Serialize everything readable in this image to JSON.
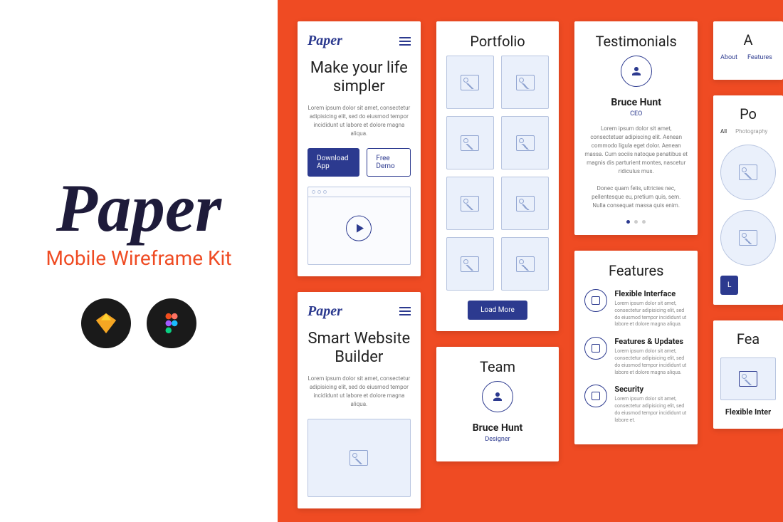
{
  "left": {
    "logo": "Paper",
    "subtitle": "Mobile Wireframe Kit"
  },
  "screens": {
    "hero": {
      "logo": "Paper",
      "title": "Make your life simpler",
      "body": "Lorem ipsum dolor sit amet, consectetur adipisicing elit, sed do eiusmod tempor incididunt ut labore et dolore magna aliqua.",
      "btn1": "Download App",
      "btn2": "Free Demo"
    },
    "builder": {
      "logo": "Paper",
      "title": "Smart Website Builder",
      "body": "Lorem ipsum dolor sit amet, consectetur adipisicing elit, sed do eiusmod tempor incididunt ut labore et dolore magna aliqua."
    },
    "portfolio": {
      "title": "Portfolio",
      "load": "Load More"
    },
    "team": {
      "title": "Team",
      "name": "Bruce Hunt",
      "role": "Designer"
    },
    "testimonials": {
      "title": "Testimonials",
      "name": "Bruce Hunt",
      "role": "CEO",
      "body": "Lorem ipsum dolor sit amet, consectetuer adipiscing elit. Aenean commodo ligula eget dolor. Aenean massa. Cum sociis natoque penatibus et magnis dis parturient montes, nascetur ridiculus mus.\n\nDonec quam felis, ultricies nec, pellentesque eu, pretium quis, sem. Nulla consequat massa quis enim."
    },
    "features": {
      "title": "Features",
      "items": [
        {
          "title": "Flexible Interface",
          "body": "Lorem ipsum dolor sit amet, consectetur adipisicing elit, sed do eiusmod tempor incididunt ut labore et dolore magna aliqua."
        },
        {
          "title": "Features & Updates",
          "body": "Lorem ipsum dolor sit amet, consectetur adipisicing elit, sed do eiusmod tempor incididunt ut labore et dolore magna aliqua."
        },
        {
          "title": "Security",
          "body": "Lorem ipsum dolor sit amet, consectetur adipisicing elit, sed do eiusmod tempor incididunt ut labore et."
        }
      ]
    },
    "about": {
      "title": "A",
      "tabs": [
        "About",
        "Features"
      ]
    },
    "portfolio2": {
      "title": "Po",
      "filters": [
        "All",
        "Photography"
      ],
      "load": "L"
    },
    "features2": {
      "title": "Fea",
      "item": "Flexible Inter"
    }
  }
}
